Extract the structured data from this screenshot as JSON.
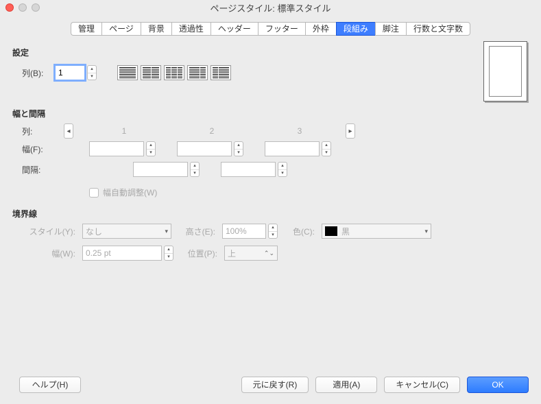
{
  "title": "ページスタイル: 標準スタイル",
  "tabs": [
    "管理",
    "ページ",
    "背景",
    "透過性",
    "ヘッダー",
    "フッター",
    "外枠",
    "段組み",
    "脚注",
    "行数と文字数"
  ],
  "activeTab": "段組み",
  "settings": {
    "section": "設定",
    "columnsLabel": "列(B):",
    "columnsValue": "1"
  },
  "width": {
    "section": "幅と間隔",
    "colLabel": "列:",
    "headers": [
      "1",
      "2",
      "3"
    ],
    "widthLabel": "幅(F):",
    "spacingLabel": "間隔:",
    "autoWidth": "幅自動調整(W)"
  },
  "separator": {
    "section": "境界線",
    "styleLabel": "スタイル(Y):",
    "styleValue": "なし",
    "heightLabel": "高さ(E):",
    "heightValue": "100%",
    "colorLabel": "色(C):",
    "colorValue": "黒",
    "widthLabel": "幅(W):",
    "widthValue": "0.25 pt",
    "posLabel": "位置(P):",
    "posValue": "上"
  },
  "buttons": {
    "help": "ヘルプ(H)",
    "reset": "元に戻す(R)",
    "apply": "適用(A)",
    "cancel": "キャンセル(C)",
    "ok": "OK"
  }
}
